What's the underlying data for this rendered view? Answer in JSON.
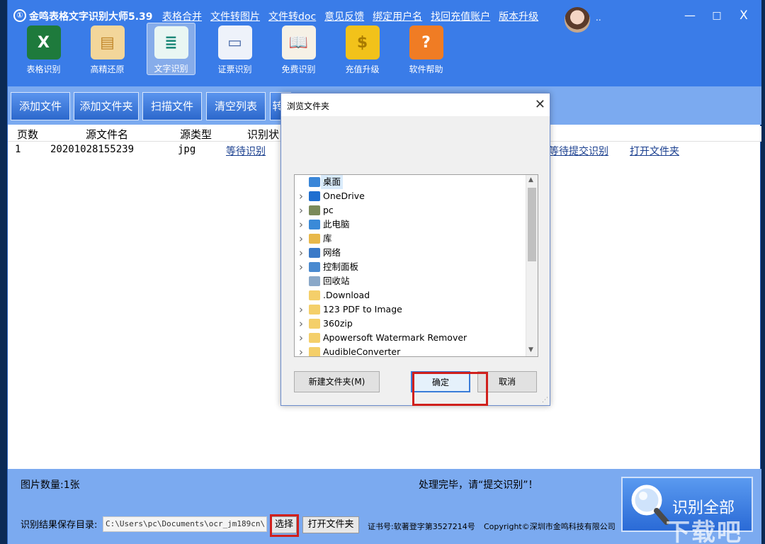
{
  "app": {
    "title": "金鸣表格文字识别大师5.39",
    "logo_glyph": "①",
    "top_links": [
      "表格合并",
      "文件转图片",
      "文件转doc",
      "意见反馈",
      "绑定用户名",
      "找回充值账户",
      "版本升级"
    ],
    "username": "..",
    "window_controls": {
      "minimize": "—",
      "maximize": "□",
      "close": "X"
    }
  },
  "toolbar": [
    {
      "label": "表格识别",
      "glyph": "X",
      "bg": "#1e7a3c",
      "color": "#ffffff",
      "icon": "excel-icon"
    },
    {
      "label": "高精还原",
      "glyph": "▤",
      "bg": "#f3d69a",
      "color": "#c0862a",
      "icon": "document-restore-icon"
    },
    {
      "label": "文字识别",
      "glyph": "≣",
      "bg": "#e9f6f3",
      "color": "#1f8a7a",
      "icon": "text-document-icon",
      "active": true
    },
    {
      "label": "证票识别",
      "glyph": "▭",
      "bg": "#eef2fa",
      "color": "#4a6aa8",
      "icon": "id-card-icon"
    },
    {
      "label": "免费识别",
      "glyph": "📖",
      "bg": "#f6f1e6",
      "color": "#6a4a2a",
      "icon": "book-owl-icon"
    },
    {
      "label": "充值升级",
      "glyph": "$",
      "bg": "#f2c21a",
      "color": "#a87a00",
      "icon": "coin-icon"
    },
    {
      "label": "软件帮助",
      "glyph": "?",
      "bg": "#f07c24",
      "color": "#ffffff",
      "icon": "help-icon"
    }
  ],
  "actions": {
    "add_file": "添加文件",
    "add_folder": "添加文件夹",
    "scan_file": "扫描文件",
    "clear_list": "清空列表",
    "partial": "转"
  },
  "list": {
    "headers": {
      "page": "页数",
      "source_name": "源文件名",
      "source_type": "源类型",
      "status": "识别状"
    },
    "rows": [
      {
        "page": "1",
        "name": "20201028155239",
        "type": "jpg",
        "status": "等待识别",
        "submit": "等待提交识别",
        "open": "打开文件夹"
      }
    ]
  },
  "bottom": {
    "image_count": "图片数量:1张",
    "status_message": "处理完毕，请“提交识别”！",
    "save_dir_label": "识别结果保存目录:",
    "save_dir_value": "C:\\Users\\pc\\Documents\\ocr_jm189cn\\",
    "choose_button": "选择",
    "open_folder_button": "打开文件夹",
    "cert": "证书号:软著登字第3527214号",
    "copyright": "Copyright©深圳市金鸣科技有限公司",
    "recognize_all": "识别全部",
    "watermark": "下载吧"
  },
  "dialog": {
    "title": "浏览文件夹",
    "close": "✕",
    "tree": [
      {
        "label": "桌面",
        "icon": "desktop-icon",
        "color": "#3a86d8",
        "chevron": false,
        "selected": true
      },
      {
        "label": "OneDrive",
        "icon": "cloud-icon",
        "color": "#1f6fd0",
        "chevron": true
      },
      {
        "label": "pc",
        "icon": "user-icon",
        "color": "#7a8a5a",
        "chevron": true
      },
      {
        "label": "此电脑",
        "icon": "computer-icon",
        "color": "#3a8ad8",
        "chevron": true
      },
      {
        "label": "库",
        "icon": "library-icon",
        "color": "#e8b84a",
        "chevron": true
      },
      {
        "label": "网络",
        "icon": "network-icon",
        "color": "#3a7ac8",
        "chevron": true
      },
      {
        "label": "控制面板",
        "icon": "control-panel-icon",
        "color": "#4a8ad0",
        "chevron": true
      },
      {
        "label": "回收站",
        "icon": "recycle-bin-icon",
        "color": "#8aa8c8",
        "chevron": false
      },
      {
        "label": ".Download",
        "icon": "folder-icon",
        "color": "#f4cf6a",
        "chevron": false
      },
      {
        "label": "123 PDF to Image",
        "icon": "folder-icon",
        "color": "#f4cf6a",
        "chevron": true
      },
      {
        "label": "360zip",
        "icon": "folder-icon",
        "color": "#f4cf6a",
        "chevron": true
      },
      {
        "label": "Apowersoft Watermark Remover",
        "icon": "folder-icon",
        "color": "#f4cf6a",
        "chevron": true
      },
      {
        "label": "AudibleConverter",
        "icon": "folder-icon",
        "color": "#f4cf6a",
        "chevron": true
      }
    ],
    "new_folder": "新建文件夹(M)",
    "ok": "确定",
    "cancel": "取消"
  },
  "colors": {
    "title_blue": "#3a7ce8",
    "panel_blue": "#7baaf0",
    "highlight_red": "#d0201c"
  }
}
